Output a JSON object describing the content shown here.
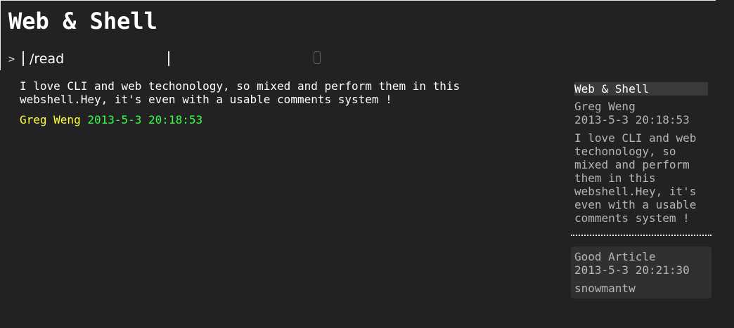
{
  "header": {
    "title": "Web & Shell"
  },
  "prompt": {
    "symbol": ">",
    "value": "/read"
  },
  "post": {
    "body": "I love CLI and web techonology, so mixed and perform them in this\nwebshell.Hey, it's even with a usable comments system !",
    "author": "Greg Weng",
    "date": "2013-5-3 20:18:53"
  },
  "sidebar": {
    "title": "Web & Shell",
    "author": "Greg Weng",
    "date": "2013-5-3 20:18:53",
    "excerpt": "I love CLI and web\ntechonology, so\nmixed and perform\nthem in this\nwebshell.Hey, it's\neven with a usable\ncomments system !",
    "comments": [
      {
        "title": "Good Article",
        "date": "2013-5-3 20:21:30",
        "author": "snowmantw"
      }
    ]
  },
  "colors": {
    "background": "#222222",
    "author": "#ffff3a",
    "date": "#3aff4a",
    "muted_text": "#b5b5b5"
  },
  "icons": {
    "prompt_device": "device-icon"
  }
}
